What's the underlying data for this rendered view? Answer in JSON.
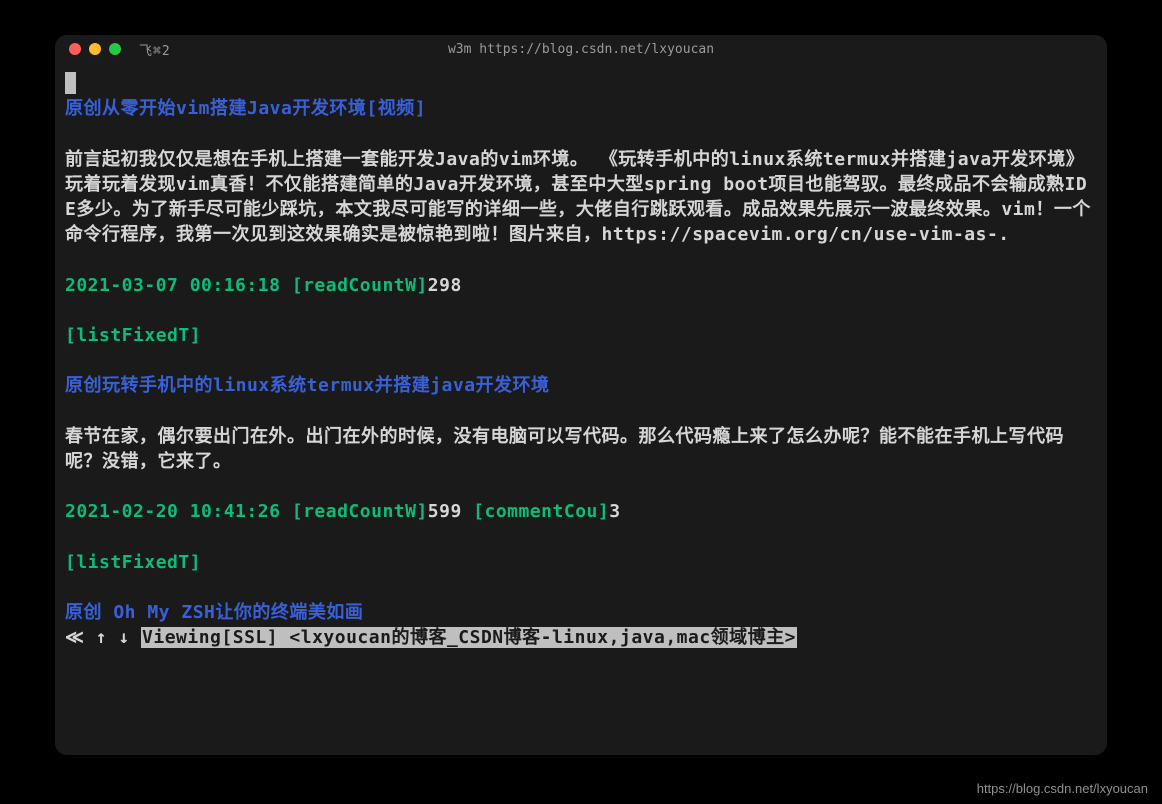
{
  "window": {
    "left_label": "飞⌘2",
    "center_title": "w3m https://blog.csdn.net/lxyoucan"
  },
  "articles": [
    {
      "title": "原创从零开始vim搭建Java开发环境[视频]",
      "body": "前言起初我仅仅是想在手机上搭建一套能开发Java的vim环境。 《玩转手机中的linux系统termux并搭建java开发环境》玩着玩着发现vim真香！不仅能搭建简单的Java开发环境，甚至中大型spring boot项目也能驾驭。最终成品不会输成熟IDE多少。为了新手尽可能少踩坑，本文我尽可能写的详细一些，大佬自行跳跃观看。成品效果先展示一波最终效果。vim！一个命令行程序，我第一次见到这效果确实是被惊艳到啦！图片来自，https://spacevim.org/cn/use-vim-as-.",
      "date": "2021-03-07 00:16:18",
      "read_label": "[readCountW]",
      "read_value": "298",
      "comment_label": "",
      "comment_value": "",
      "fixed": "[listFixedT]"
    },
    {
      "title": "原创玩转手机中的linux系统termux并搭建java开发环境",
      "body": "春节在家，偶尔要出门在外。出门在外的时候，没有电脑可以写代码。那么代码瘾上来了怎么办呢？能不能在手机上写代码呢？没错，它来了。",
      "date": "2021-02-20 10:41:26",
      "read_label": "[readCountW]",
      "read_value": "599",
      "comment_label": "[commentCou]",
      "comment_value": "3",
      "fixed": "[listFixedT]"
    },
    {
      "title": "原创 Oh My ZSH让你的终端美如画",
      "body": "",
      "date": "",
      "read_label": "",
      "read_value": "",
      "comment_label": "",
      "comment_value": "",
      "fixed": ""
    }
  ],
  "statusbar": {
    "prefix": "≪ ↑ ↓ ",
    "text": "Viewing[SSL] <lxyoucan的博客_CSDN博客-linux,java,mac领域博主>"
  },
  "watermark": "https://blog.csdn.net/lxyoucan"
}
